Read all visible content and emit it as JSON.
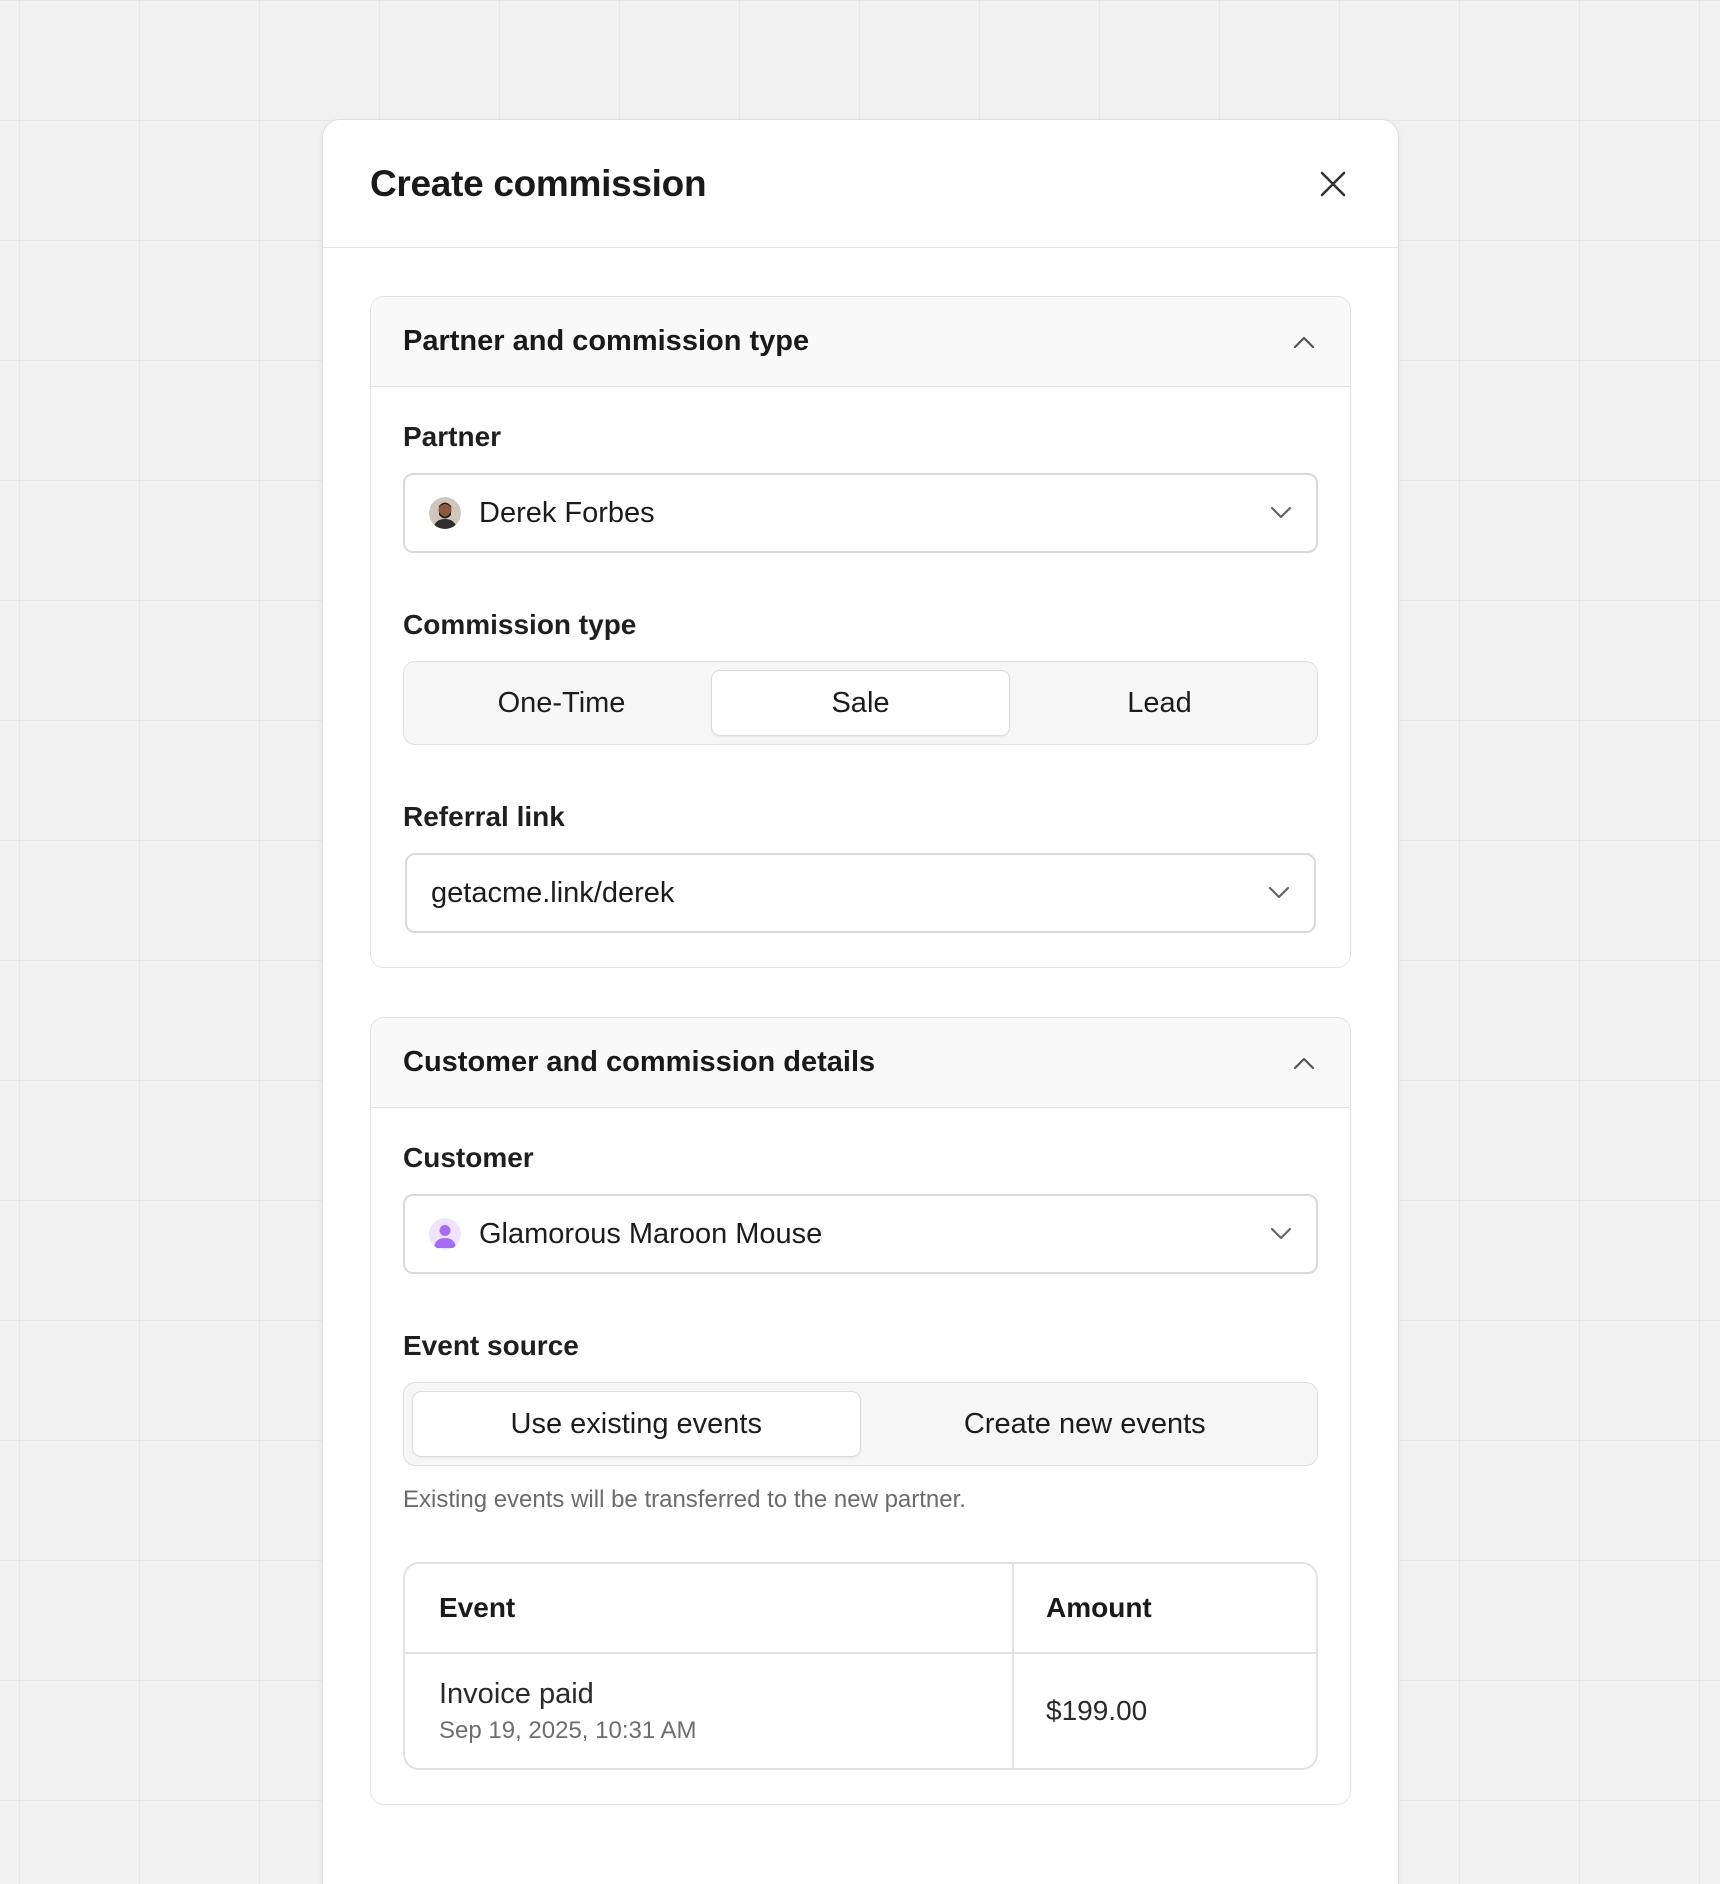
{
  "modal": {
    "title": "Create commission"
  },
  "section1": {
    "title": "Partner and commission type",
    "partner_label": "Partner",
    "partner_value": "Derek Forbes",
    "commission_type_label": "Commission type",
    "commission_types": [
      "One-Time",
      "Sale",
      "Lead"
    ],
    "commission_type_selected": "Sale",
    "referral_label": "Referral link",
    "referral_value": "getacme.link/derek"
  },
  "section2": {
    "title": "Customer and commission details",
    "customer_label": "Customer",
    "customer_value": "Glamorous Maroon Mouse",
    "event_source_label": "Event source",
    "event_sources": [
      "Use existing events",
      "Create new events"
    ],
    "event_source_selected": "Use existing events",
    "helper_text": "Existing events will be transferred to the new partner.",
    "table": {
      "columns": [
        "Event",
        "Amount"
      ],
      "rows": [
        {
          "event": "Invoice paid",
          "date": "Sep 19, 2025, 10:31 AM",
          "amount": "$199.00"
        }
      ]
    }
  },
  "colors": {
    "background": "#f1f1f1",
    "border": "#e2e2e2",
    "customer_avatar": "#a46cf0"
  },
  "icons": [
    "close-icon",
    "chevron-up-icon",
    "chevron-down-icon",
    "partner-avatar",
    "customer-avatar"
  ]
}
